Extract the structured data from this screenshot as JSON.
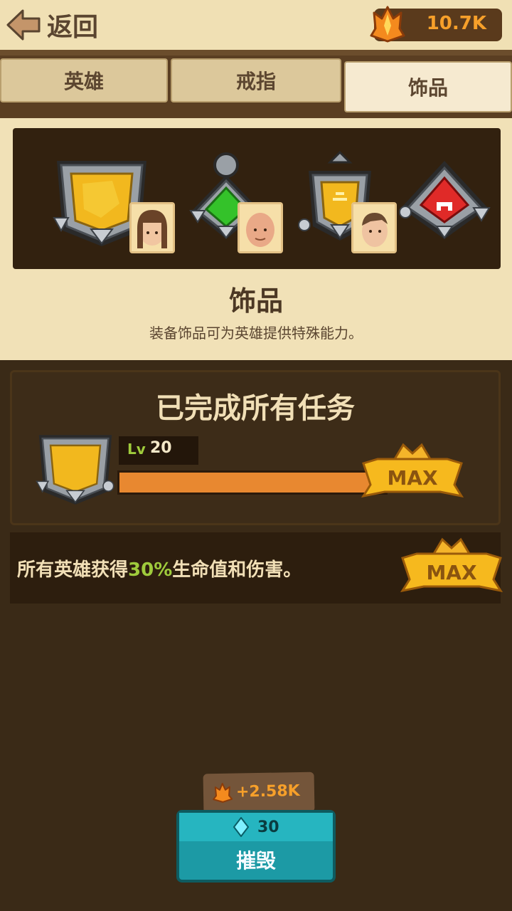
{
  "header": {
    "back_label": "返回",
    "currency_value": "10.7K"
  },
  "tabs": [
    {
      "label": "英雄",
      "active": false
    },
    {
      "label": "戒指",
      "active": false
    },
    {
      "label": "饰品",
      "active": true
    }
  ],
  "info": {
    "title": "饰品",
    "description": "装备饰品可为英雄提供特殊能力。"
  },
  "quest": {
    "title": "已完成所有任务",
    "level_prefix": "Lv",
    "level": "20",
    "progress": 1.0,
    "max_label": "MAX"
  },
  "bonus": {
    "text_before": "所有英雄获得",
    "highlight": "30%",
    "text_after": "生命值和伤害。",
    "max_label": "MAX"
  },
  "action": {
    "refund": "+2.58K",
    "gem_cost": "30",
    "label": "摧毁"
  },
  "colors": {
    "accent_orange": "#f7a02a",
    "highlight_green": "#9fcb3c",
    "button_teal": "#1c9aa5"
  }
}
